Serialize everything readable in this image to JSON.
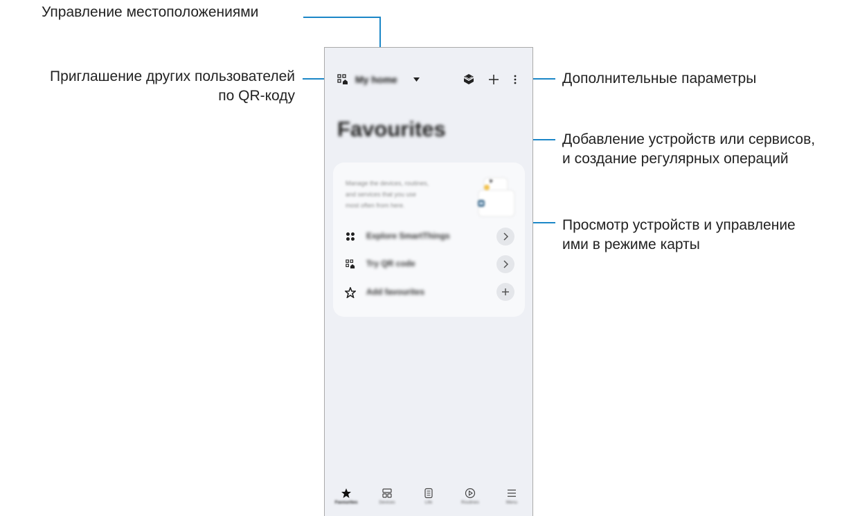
{
  "callouts": {
    "location": "Управление местоположениями",
    "invite_line1": "Приглашение других пользователей",
    "invite_line2": "по QR-коду",
    "more_options": "Дополнительные параметры",
    "add_line1": "Добавление устройств или сервисов,",
    "add_line2": "и создание регулярных операций",
    "map_line1": "Просмотр устройств и управление",
    "map_line2": "ими в режиме карты"
  },
  "app": {
    "location_name": "My home",
    "page_title": "Favourites",
    "card_text_line1": "Manage the devices, routines,",
    "card_text_line2": "and services that you use",
    "card_text_line3": "most often from here.",
    "items": [
      {
        "label": "Explore SmartThings",
        "action": "chevron-right"
      },
      {
        "label": "Try QR code",
        "action": "chevron-right"
      },
      {
        "label": "Add favourites",
        "action": "plus"
      }
    ],
    "tabs": [
      {
        "label": "Favourites",
        "icon": "star-icon",
        "active": true
      },
      {
        "label": "Devices",
        "icon": "grid-icon",
        "active": false
      },
      {
        "label": "Life",
        "icon": "list-icon",
        "active": false
      },
      {
        "label": "Routines",
        "icon": "play-circle-icon",
        "active": false
      },
      {
        "label": "Menu",
        "icon": "menu-icon",
        "active": false
      }
    ]
  },
  "colors": {
    "callout_line": "#1a86c7",
    "phone_bg": "#eef0f5"
  }
}
